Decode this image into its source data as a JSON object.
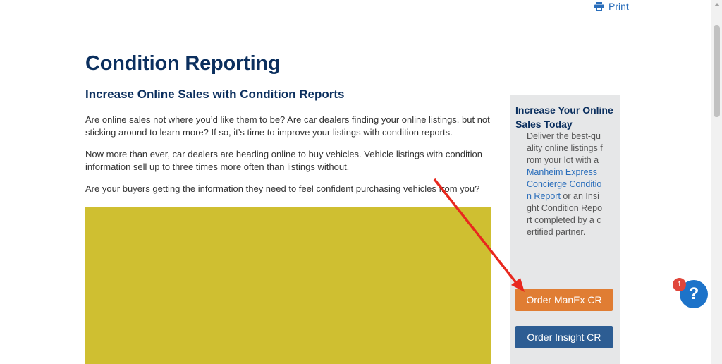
{
  "header": {
    "print_label": "Print"
  },
  "main": {
    "title": "Condition Reporting",
    "subtitle": "Increase Online Sales with Condition Reports",
    "paragraphs": [
      "Are online sales not where you’d like them to be? Are car dealers finding your online listings, but not sticking around to learn more? If so, it’s time to improve your listings with condition reports.",
      "Now more than ever, car dealers are heading online to buy vehicles. Vehicle listings with condition information sell up to three times more often than listings without.",
      "Are your buyers getting the information they need to feel confident purchasing vehicles from you?"
    ]
  },
  "sidebar": {
    "heading": "Increase Your Online Sales Today",
    "text_before": "Deliver the best-quality online listings from your lot with a ",
    "link1": "Manheim Express Concierge Condition Report",
    "text_middle": " or an Insight Condition Report completed by a certified partner.",
    "button_manex": "Order ManEx CR",
    "button_insight": "Order Insight CR"
  },
  "help": {
    "badge_count": "1",
    "icon_glyph": "?"
  },
  "colors": {
    "title": "#0b2f5e",
    "link": "#2a6ebb",
    "manex_button": "#e07d33",
    "insight_button": "#2d5d93",
    "annotation_arrow": "#e8281e"
  }
}
